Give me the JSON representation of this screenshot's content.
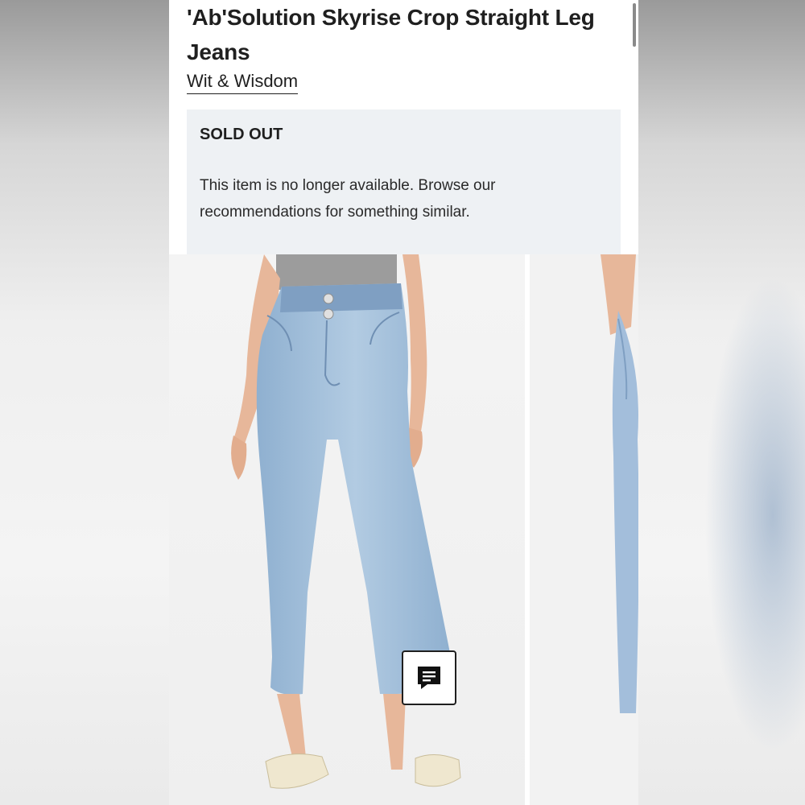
{
  "product": {
    "title": "'Ab'Solution Skyrise Crop Straight Leg Jeans",
    "brand": "Wit & Wisdom"
  },
  "availability": {
    "status": "SOLD OUT",
    "message": "This item is no longer available. Browse our recommendations for something similar."
  },
  "gallery": {
    "images": [
      {
        "name": "front-view-jeans-photo"
      },
      {
        "name": "side-view-jeans-photo"
      }
    ]
  },
  "chat": {
    "icon": "chat-icon"
  },
  "colors": {
    "notice_bg": "#eef1f4",
    "denim": "#a9c3dc",
    "text": "#1f1f1f"
  }
}
